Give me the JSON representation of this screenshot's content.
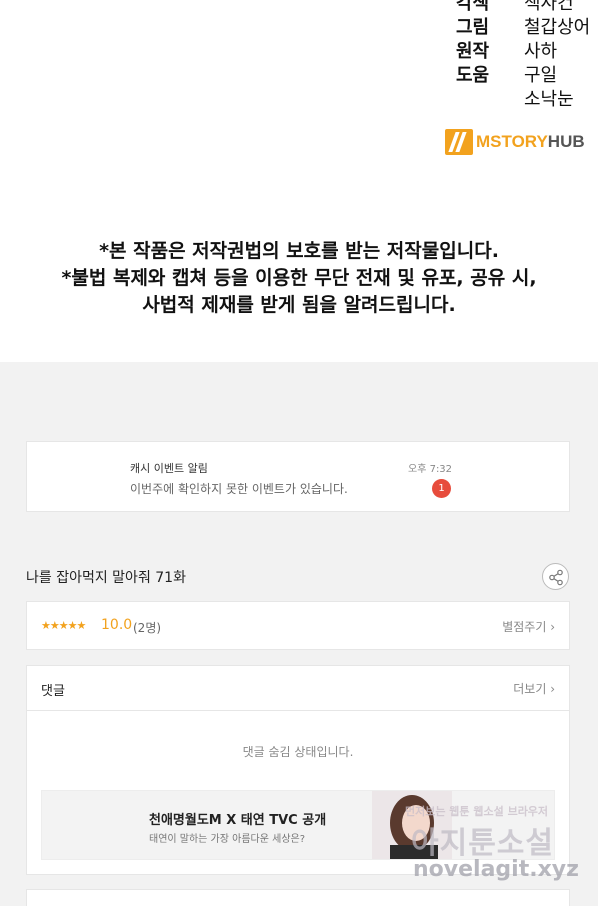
{
  "credits": {
    "rows": [
      {
        "role": "각색",
        "value": "책사건"
      },
      {
        "role": "그림",
        "value": "철갑상어"
      },
      {
        "role": "원작",
        "value": "사하"
      },
      {
        "role": "도움",
        "value": "구일"
      }
    ],
    "extra": "소낙눈"
  },
  "logo": {
    "text_main": "MSTORY",
    "text_hub": "HUB",
    "icon": "mstoryhub-logo-icon"
  },
  "notice": {
    "line1": "*본 작품은 저작권법의 보호를 받는 저작물입니다.",
    "line2": "*불법 복제와 캡쳐 등을 이용한 무단 전재 및 유포, 공유 시,",
    "line3": "사법적 제재를 받게 됨을 알려드립니다."
  },
  "event_alert": {
    "title": "캐시 이벤트 알림",
    "message": "이번주에 확인하지 못한 이벤트가 있습니다.",
    "time": "오후 7:32",
    "badge": "1"
  },
  "episode": {
    "title": "나를 잡아먹지 말아줘 71화",
    "share_icon": "share-icon"
  },
  "rating": {
    "stars": "★★★★★",
    "score": "10.0",
    "count": "(2명)",
    "action": "별점주기 ›"
  },
  "comments": {
    "title": "댓글",
    "more": "더보기 ›",
    "hidden_notice": "댓글 숨김 상태입니다."
  },
  "ad": {
    "title": "천애명월도M X 태연 TVC 공개",
    "subtitle": "태연이 말하는 가장 아름다운 세상은?"
  },
  "watermark": {
    "line1": "먼저보는 웹툰 웹소설 브라우저",
    "line2": "아지툰소설",
    "line3": "novelagit.xyz"
  },
  "colors": {
    "accent": "#f2a21e",
    "badge": "#e74c3c",
    "background": "#f2f2f2"
  }
}
